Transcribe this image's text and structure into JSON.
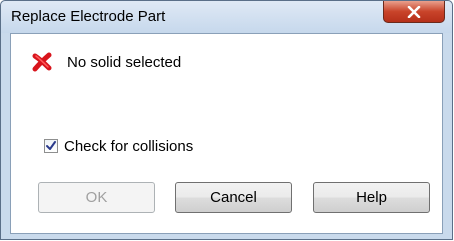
{
  "window": {
    "title": "Replace Electrode Part",
    "close_icon": "close-x-icon"
  },
  "status": {
    "icon": "red-x-error-icon",
    "icon_color": "#d8141c",
    "text": "No solid selected"
  },
  "collision_check": {
    "label": "Check for collisions",
    "checked": true
  },
  "buttons": {
    "ok_label": "OK",
    "ok_enabled": false,
    "cancel_label": "Cancel",
    "help_label": "Help"
  }
}
